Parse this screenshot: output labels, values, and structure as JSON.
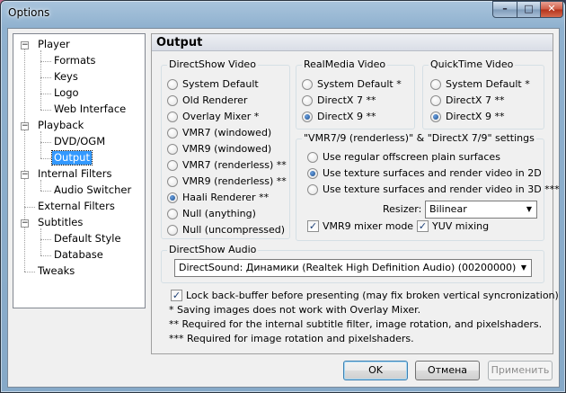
{
  "window": {
    "title": "Options",
    "min_glyph": "–",
    "max_glyph": "□",
    "close_glyph": "✕"
  },
  "tree": {
    "items": [
      {
        "label": "Player",
        "level": 0,
        "expanded": true
      },
      {
        "label": "Formats",
        "level": 1
      },
      {
        "label": "Keys",
        "level": 1
      },
      {
        "label": "Logo",
        "level": 1
      },
      {
        "label": "Web Interface",
        "level": 1
      },
      {
        "label": "Playback",
        "level": 0,
        "expanded": true
      },
      {
        "label": "DVD/OGM",
        "level": 1
      },
      {
        "label": "Output",
        "level": 1,
        "selected": true
      },
      {
        "label": "Internal Filters",
        "level": 0,
        "expanded": true
      },
      {
        "label": "Audio Switcher",
        "level": 1
      },
      {
        "label": "External Filters",
        "level": 0
      },
      {
        "label": "Subtitles",
        "level": 0,
        "expanded": true
      },
      {
        "label": "Default Style",
        "level": 1
      },
      {
        "label": "Database",
        "level": 1
      },
      {
        "label": "Tweaks",
        "level": 0
      }
    ],
    "expander_glyph": "−"
  },
  "panel": {
    "title": "Output"
  },
  "directshow_video": {
    "label": "DirectShow Video",
    "options": [
      {
        "label": "System Default",
        "checked": false
      },
      {
        "label": "Old Renderer",
        "checked": false
      },
      {
        "label": "Overlay Mixer *",
        "checked": false
      },
      {
        "label": "VMR7 (windowed)",
        "checked": false
      },
      {
        "label": "VMR9 (windowed)",
        "checked": false
      },
      {
        "label": "VMR7 (renderless) **",
        "checked": false
      },
      {
        "label": "VMR9 (renderless) **",
        "checked": false
      },
      {
        "label": "Haali Renderer **",
        "checked": true
      },
      {
        "label": "Null (anything)",
        "checked": false
      },
      {
        "label": "Null (uncompressed)",
        "checked": false
      }
    ]
  },
  "realmedia_video": {
    "label": "RealMedia Video",
    "options": [
      {
        "label": "System Default *",
        "checked": false
      },
      {
        "label": "DirectX 7 **",
        "checked": false
      },
      {
        "label": "DirectX 9 **",
        "checked": true
      }
    ]
  },
  "quicktime_video": {
    "label": "QuickTime Video",
    "options": [
      {
        "label": "System Default *",
        "checked": false
      },
      {
        "label": "DirectX 7 **",
        "checked": false
      },
      {
        "label": "DirectX 9 **",
        "checked": true
      }
    ]
  },
  "renderless_settings": {
    "label": "\"VMR7/9 (renderless)\" & \"DirectX 7/9\" settings",
    "options": [
      {
        "label": "Use regular offscreen plain surfaces",
        "checked": false
      },
      {
        "label": "Use texture surfaces and render video in 2D",
        "checked": true
      },
      {
        "label": "Use texture surfaces and render video in 3D ***",
        "checked": false
      }
    ],
    "resizer_label": "Resizer:",
    "resizer_value": "Bilinear",
    "vmr9_mixer_label": "VMR9 mixer mode",
    "vmr9_mixer_checked": true,
    "yuv_mixing_label": "YUV mixing",
    "yuv_mixing_checked": true
  },
  "directshow_audio": {
    "label": "DirectShow Audio",
    "device": "DirectSound: Динамики (Realtek High Definition Audio) (00200000)"
  },
  "lock_backbuffer": {
    "label": "Lock back-buffer before presenting (may fix broken vertical syncronization)",
    "checked": true
  },
  "notes": [
    "* Saving images does not work with Overlay Mixer.",
    "** Required for the internal subtitle filter, image rotation, and pixelshaders.",
    "*** Required for image rotation and pixelshaders."
  ],
  "buttons": {
    "ok": "OK",
    "cancel": "Отмена",
    "apply": "Применить"
  },
  "glyphs": {
    "check": "✓",
    "dropdown": "▼"
  }
}
